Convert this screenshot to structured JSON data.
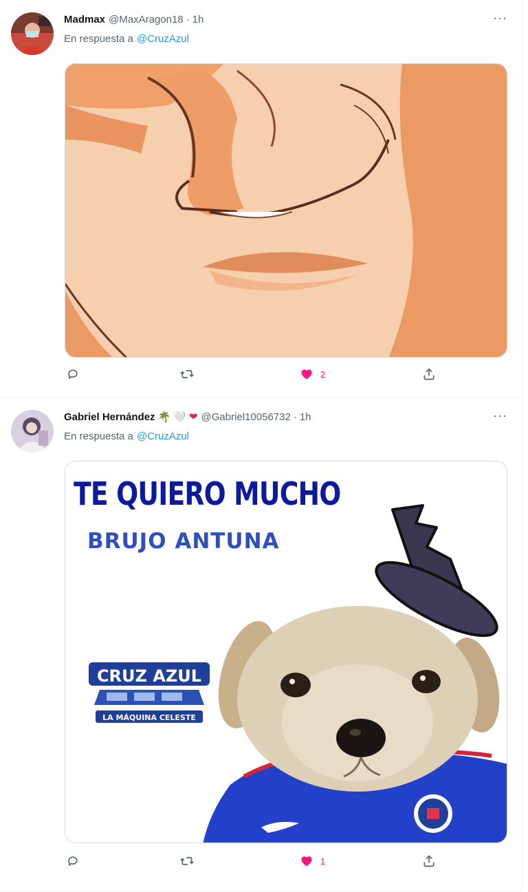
{
  "tweets": [
    {
      "name": "Madmax",
      "handle": "@MaxAragon18",
      "separator": "·",
      "time": "1h",
      "reply_prefix": "En respuesta a",
      "reply_to": "@CruzAzul",
      "more": "···",
      "media": {
        "description_icon": "anime-smirk-image"
      },
      "actions": {
        "reply_count": "",
        "retweet_count": "",
        "like_count": "2",
        "liked": true
      }
    },
    {
      "name": "Gabriel Hernández",
      "name_emojis": [
        "🌴",
        "🤍",
        "❤"
      ],
      "handle": "@Gabriel10056732",
      "separator": "·",
      "time": "1h",
      "reply_prefix": "En respuesta a",
      "reply_to": "@CruzAzul",
      "more": "···",
      "media": {
        "title": "TE QUIERO MUCHO",
        "subtitle": "BRUJO ANTUNA",
        "logo_text_top": "CRUZ AZUL",
        "logo_text_bottom": "LA MÁQUINA CELESTE"
      },
      "actions": {
        "reply_count": "",
        "retweet_count": "",
        "like_count": "1",
        "liked": true
      }
    }
  ],
  "colors": {
    "link": "#1d9bf0",
    "like": "#f91880",
    "secondary_text": "#536471",
    "meme_title": "#0d1a9e",
    "meme_subtitle": "#2f4fc0"
  }
}
